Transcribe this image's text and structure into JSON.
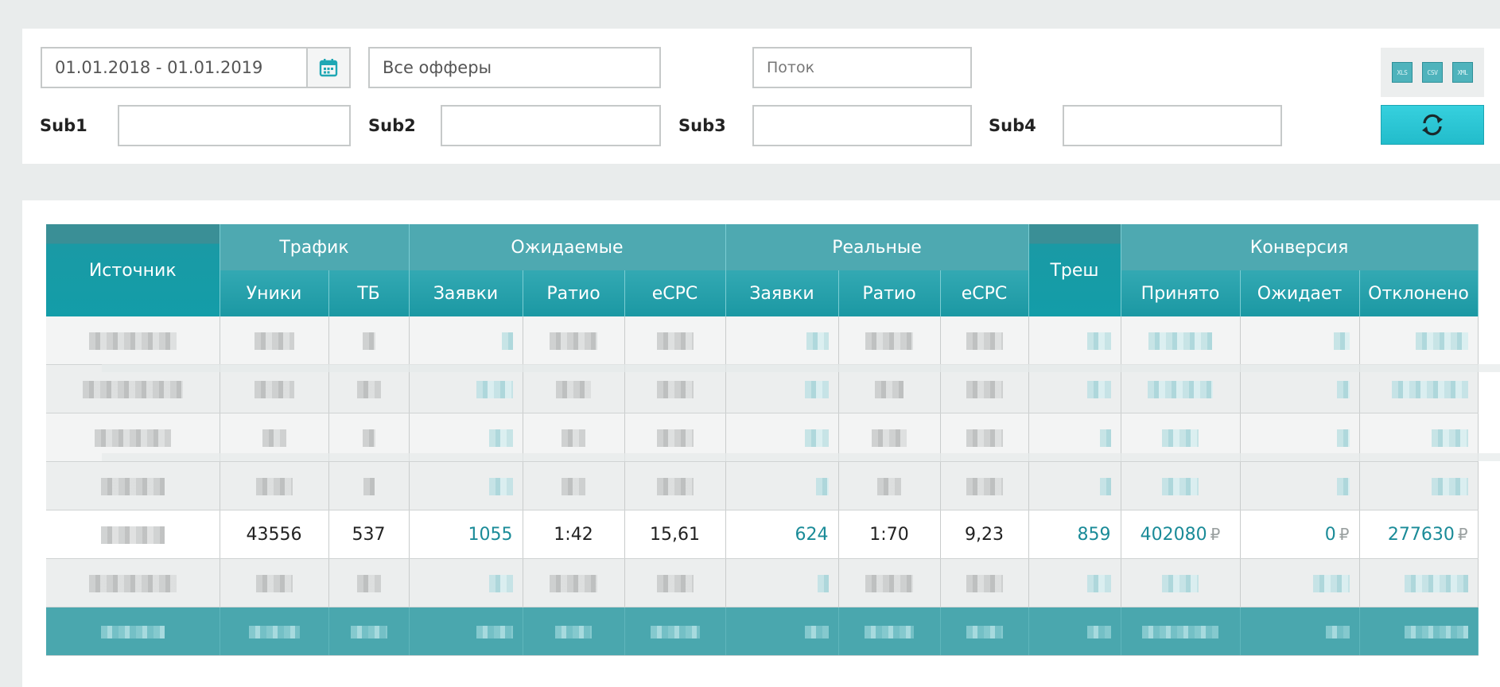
{
  "filters": {
    "date_range": "01.01.2018 - 01.01.2019",
    "offers_value": "Все офферы",
    "stream_placeholder": "Поток",
    "sub1_label": "Sub1",
    "sub2_label": "Sub2",
    "sub3_label": "Sub3",
    "sub4_label": "Sub4",
    "sub1_value": "",
    "sub2_value": "",
    "sub3_value": "",
    "sub4_value": "",
    "export": [
      "XLS",
      "CSV",
      "XML"
    ],
    "refresh_icon": "refresh-icon",
    "calendar_icon": "calendar-icon"
  },
  "table": {
    "groups": {
      "source": "Источник",
      "traffic": "Трафик",
      "expected": "Ожидаемые",
      "real": "Реальные",
      "trash": "Треш",
      "conversion": "Конверсия"
    },
    "columns": {
      "uniques": "Уники",
      "tb": "ТБ",
      "exp_orders": "Заявки",
      "exp_ratio": "Ратио",
      "exp_ecpc": "eCPC",
      "real_orders": "Заявки",
      "real_ratio": "Ратио",
      "real_ecpc": "eCPC",
      "accepted": "Принято",
      "pending": "Ожидает",
      "rejected": "Отклонено"
    },
    "visible_row": {
      "uniques": "43556",
      "tb": "537",
      "exp_orders": "1055",
      "exp_ratio": "1:42",
      "exp_ecpc": "15,61",
      "real_orders": "624",
      "real_ratio": "1:70",
      "real_ecpc": "9,23",
      "trash": "859",
      "accepted": "402080",
      "pending": "0",
      "rejected": "277630",
      "currency": "₽"
    }
  },
  "colors": {
    "header_teal": "#1b98a3",
    "accent_text": "#1a8b98",
    "button_teal": "#2cc6d4"
  }
}
